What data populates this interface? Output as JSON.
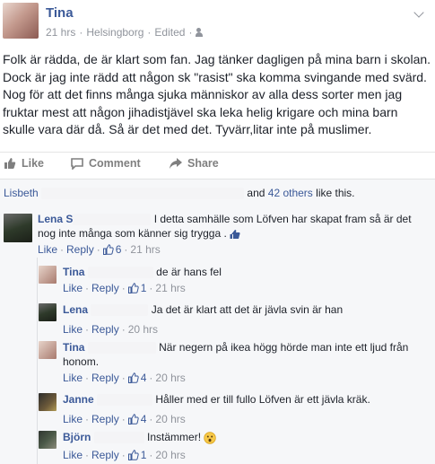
{
  "post": {
    "author": "Tina",
    "time": "21 hrs",
    "location": "Helsingborg",
    "edited": "Edited",
    "separator": "·",
    "text": "Folk är rädda, de är klart som fan. Jag tänker dagligen på mina barn i skolan. Dock är jag inte rädd att någon sk \"rasist\" ska komma svingande med svärd. Nog för att det finns många sjuka människor av alla dess sorter men jag fruktar mest att någon jihadistjävel ska leka helig krigare och mina barn skulle vara där då. Så är det med det. Tyvärr,litar inte på muslimer."
  },
  "actions": {
    "like": "Like",
    "comment": "Comment",
    "share": "Share"
  },
  "likes": {
    "first_name": "Lisbeth",
    "and": "and",
    "others": "42 others",
    "suffix": "like this."
  },
  "comments": [
    {
      "name": "Lena",
      "name_fragment": "S",
      "text": "I detta samhälle som Löfven har skapat fram så är det nog inte många som känner sig trygga .",
      "like": "Like",
      "reply": "Reply",
      "count": "6",
      "time": "21 hrs",
      "sep": "·"
    },
    {
      "name": "Tina",
      "text": "de är hans fel",
      "like": "Like",
      "reply": "Reply",
      "count": "1",
      "time": "21 hrs",
      "sep": "·"
    },
    {
      "name": "Lena",
      "text": "Ja det är klart att det är jävla svin är han",
      "like": "Like",
      "reply": "Reply",
      "time": "20 hrs",
      "sep": "·"
    },
    {
      "name": "Tina",
      "text": "När negern på ikea högg hörde man inte ett ljud från honom.",
      "like": "Like",
      "reply": "Reply",
      "count": "4",
      "time": "20 hrs",
      "sep": "·"
    },
    {
      "name": "Janne",
      "text": "Håller med er till fullo Löfven är ett jävla kräk.",
      "like": "Like",
      "reply": "Reply",
      "count": "4",
      "time": "20 hrs",
      "sep": "·"
    },
    {
      "name": "Björn",
      "text": "Instämmer!",
      "like": "Like",
      "reply": "Reply",
      "count": "1",
      "time": "20 hrs",
      "sep": "·"
    }
  ],
  "colors": {
    "link": "#3b5998",
    "meta": "#90949c",
    "text": "#1d2129"
  },
  "icons": [
    "chevron-down-icon",
    "audience-icon",
    "like-icon",
    "comment-icon",
    "share-icon",
    "thumbs-up-icon",
    "emoji-icon"
  ]
}
